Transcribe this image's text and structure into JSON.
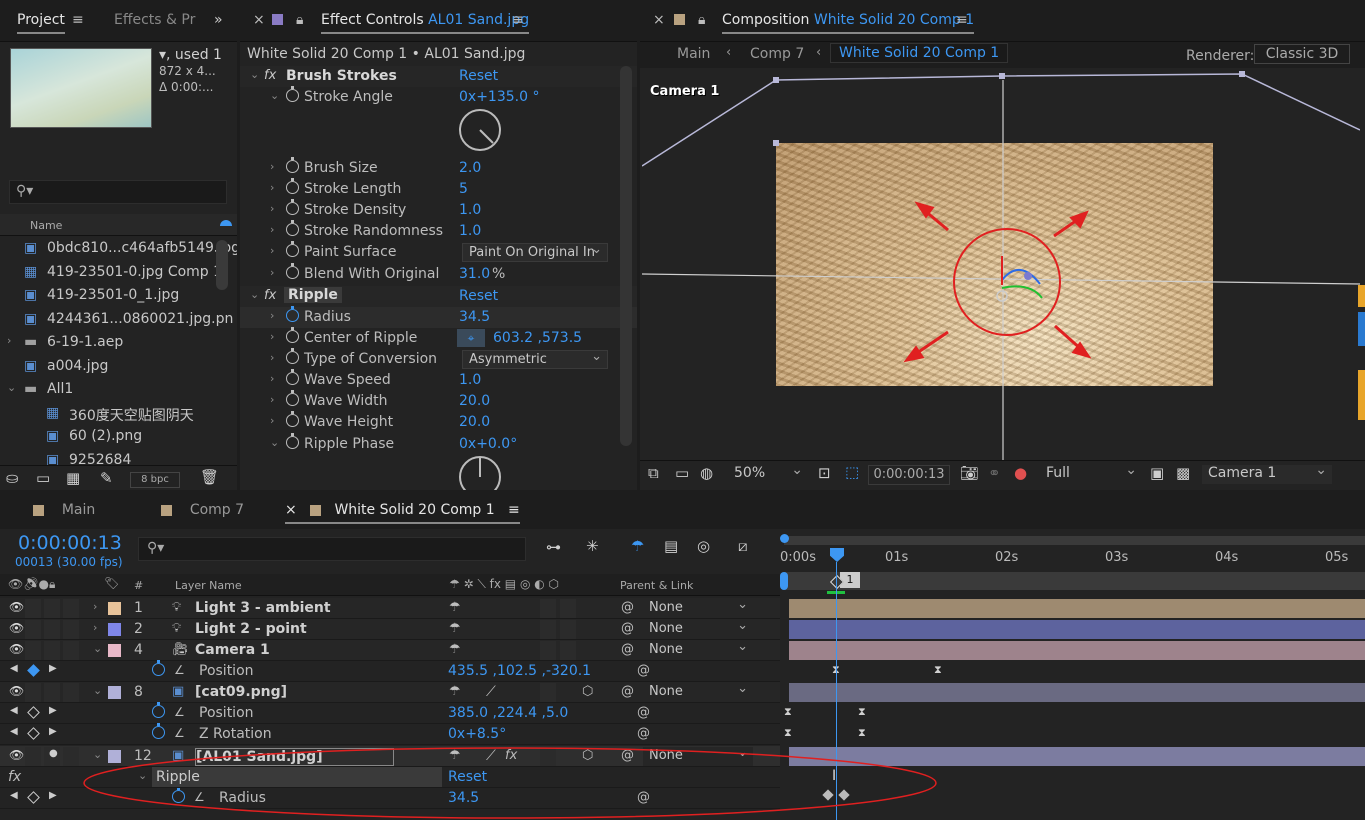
{
  "project": {
    "tab_label": "Project",
    "tab2_label": "Effects & Pr",
    "info_line1": "▾, used 1",
    "info_line2": "872 x 4...",
    "info_line3": "Δ 0:00:...",
    "name_header": "Name",
    "bpc": "8 bpc",
    "items": [
      {
        "name": "0bdc810...c464afb5149.jpg",
        "icon": "image-file-icon"
      },
      {
        "name": "419-23501-0.jpg Comp 1",
        "icon": "composition-icon"
      },
      {
        "name": "419-23501-0_1.jpg",
        "icon": "image-file-icon"
      },
      {
        "name": "4244361...0860021.jpg.pn",
        "icon": "image-file-icon"
      },
      {
        "name": "6-19-1.aep",
        "icon": "folder-icon"
      },
      {
        "name": "a004.jpg",
        "icon": "image-file-icon"
      },
      {
        "name": "All1",
        "icon": "folder-icon"
      },
      {
        "name": "360度天空贴图阴天",
        "icon": "composition-icon"
      },
      {
        "name": "60 (2).png",
        "icon": "image-file-icon"
      },
      {
        "name": "9252684",
        "icon": "image-file-icon"
      }
    ]
  },
  "effect_controls": {
    "tab_title": "Effect Controls",
    "tab_target": "AL01 Sand.jpg",
    "breadcrumb": "White Solid 20 Comp 1 • AL01 Sand.jpg",
    "brush_strokes": {
      "name": "Brush Strokes",
      "reset": "Reset",
      "stroke_angle_label": "Stroke Angle",
      "stroke_angle_value": "0x+135.0 °",
      "brush_size_label": "Brush Size",
      "brush_size_value": "2.0",
      "stroke_length_label": "Stroke Length",
      "stroke_length_value": "5",
      "stroke_density_label": "Stroke Density",
      "stroke_density_value": "1.0",
      "stroke_randomness_label": "Stroke Randomness",
      "stroke_randomness_value": "1.0",
      "paint_surface_label": "Paint Surface",
      "paint_surface_value": "Paint On Original In",
      "blend_label": "Blend With Original",
      "blend_value": "31.0",
      "blend_unit": "%"
    },
    "ripple": {
      "name": "Ripple",
      "reset": "Reset",
      "radius_label": "Radius",
      "radius_value": "34.5",
      "center_label": "Center of Ripple",
      "center_value": "603.2 ,573.5",
      "conversion_label": "Type of Conversion",
      "conversion_value": "Asymmetric",
      "wave_speed_label": "Wave Speed",
      "wave_speed_value": "1.0",
      "wave_width_label": "Wave Width",
      "wave_width_value": "20.0",
      "wave_height_label": "Wave Height",
      "wave_height_value": "20.0",
      "phase_label": "Ripple Phase",
      "phase_value": "0x+0.0°"
    }
  },
  "composition": {
    "tab_prefix": "Composition",
    "tab_name": "White Solid 20 Comp 1",
    "crumbs": [
      "Main",
      "Comp 7",
      "White Solid 20 Comp 1"
    ],
    "renderer_label": "Renderer:",
    "renderer_value": "Classic 3D",
    "camera_label": "Camera 1",
    "zoom": "50%",
    "timecode": "0:00:00:13",
    "resolution": "Full",
    "view": "Camera 1"
  },
  "timeline": {
    "tabs": [
      "Main",
      "Comp 7",
      "White Solid 20 Comp 1"
    ],
    "timecode": "0:00:00:13",
    "frames": "00013 (30.00 fps)",
    "search_placeholder": "",
    "col_num": "#",
    "col_layer": "Layer Name",
    "col_parent": "Parent & Link",
    "ruler": [
      "0:00s",
      "01s",
      "02s",
      "03s",
      "04s",
      "05s"
    ],
    "marker": "1",
    "layers": [
      {
        "num": "1",
        "name": "Light 3 - ambient",
        "parent": "None",
        "color": "#e8c39a"
      },
      {
        "num": "2",
        "name": "Light 2 - point",
        "parent": "None",
        "color": "#7f86e8"
      },
      {
        "num": "4",
        "name": "Camera 1",
        "parent": "None",
        "color": "#e8b8c8"
      },
      {
        "num": "8",
        "name": "[cat09.png]",
        "parent": "None",
        "color": "#b0b0d8"
      },
      {
        "num": "12",
        "name": "[AL01 Sand.jpg]",
        "parent": "None",
        "color": "#b0b0d8"
      }
    ],
    "cam_position_label": "Position",
    "cam_position_value": "435.5 ,102.5 ,-320.1",
    "cat_position_label": "Position",
    "cat_position_value": "385.0 ,224.4 ,5.0",
    "cat_rotation_label": "Z Rotation",
    "cat_rotation_value": "0x+8.5°",
    "ripple_label": "Ripple",
    "ripple_reset": "Reset",
    "radius_label": "Radius",
    "radius_value": "34.5",
    "fx_label": "fx"
  },
  "colors": {
    "accent": "#3d97f2",
    "bar_light3": "#9e8a70",
    "bar_light2": "#5d639e",
    "bar_camera": "#9e838c",
    "bar_cat": "#6a6a82",
    "bar_sand": "#7c7ca0",
    "annotation_red": "#e02020"
  }
}
